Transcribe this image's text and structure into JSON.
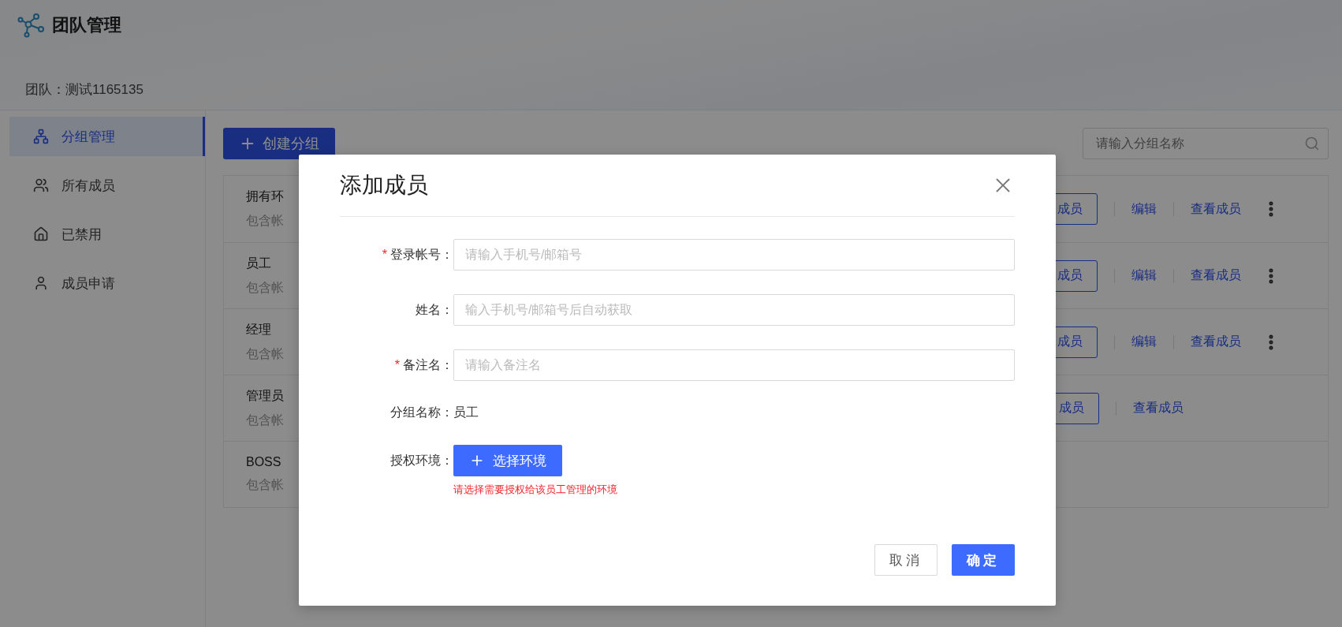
{
  "header": {
    "title": "团队管理",
    "team": "团队：测试1165135"
  },
  "sidebar": {
    "items": [
      {
        "label": "分组管理",
        "selected": true
      },
      {
        "label": "所有成员",
        "selected": false
      },
      {
        "label": "已禁用",
        "selected": false
      },
      {
        "label": "成员申请",
        "selected": false
      }
    ]
  },
  "toolbar": {
    "create_button": "创建分组",
    "search": {
      "placeholder": "请输入分组名称"
    }
  },
  "groups": [
    {
      "name": "拥有环",
      "subtitle": "包含帐",
      "add_button": "成员",
      "edit": "编辑",
      "view": "查看成员",
      "more": true
    },
    {
      "name": "员工",
      "subtitle": "包含帐",
      "add_button": "成员",
      "edit": "编辑",
      "view": "查看成员",
      "more": true
    },
    {
      "name": "经理",
      "subtitle": "包含帐",
      "add_button": "成员",
      "edit": "编辑",
      "view": "查看成员",
      "more": true
    },
    {
      "name": "管理员",
      "subtitle": "包含帐",
      "add_button": "成员",
      "view": "查看成员"
    },
    {
      "name": "BOSS",
      "subtitle": "包含帐"
    }
  ],
  "dialog": {
    "title": "添加成员",
    "fields": [
      {
        "label": "登录帐号：",
        "required_mark": "*",
        "placeholder": "请输入手机号/邮箱号"
      },
      {
        "label": "姓名：",
        "placeholder": "输入手机号/邮箱号后自动获取"
      },
      {
        "label": "备注名：",
        "required_mark": "*",
        "placeholder": "请输入备注名"
      }
    ],
    "group": {
      "label": "分组名称：",
      "value": "员工"
    },
    "environment": {
      "label": "授权环境：",
      "button": "选择环境",
      "hint": "请选择需要授权给该员工管理的环境"
    },
    "cancel": "取消",
    "confirm": "确定"
  }
}
